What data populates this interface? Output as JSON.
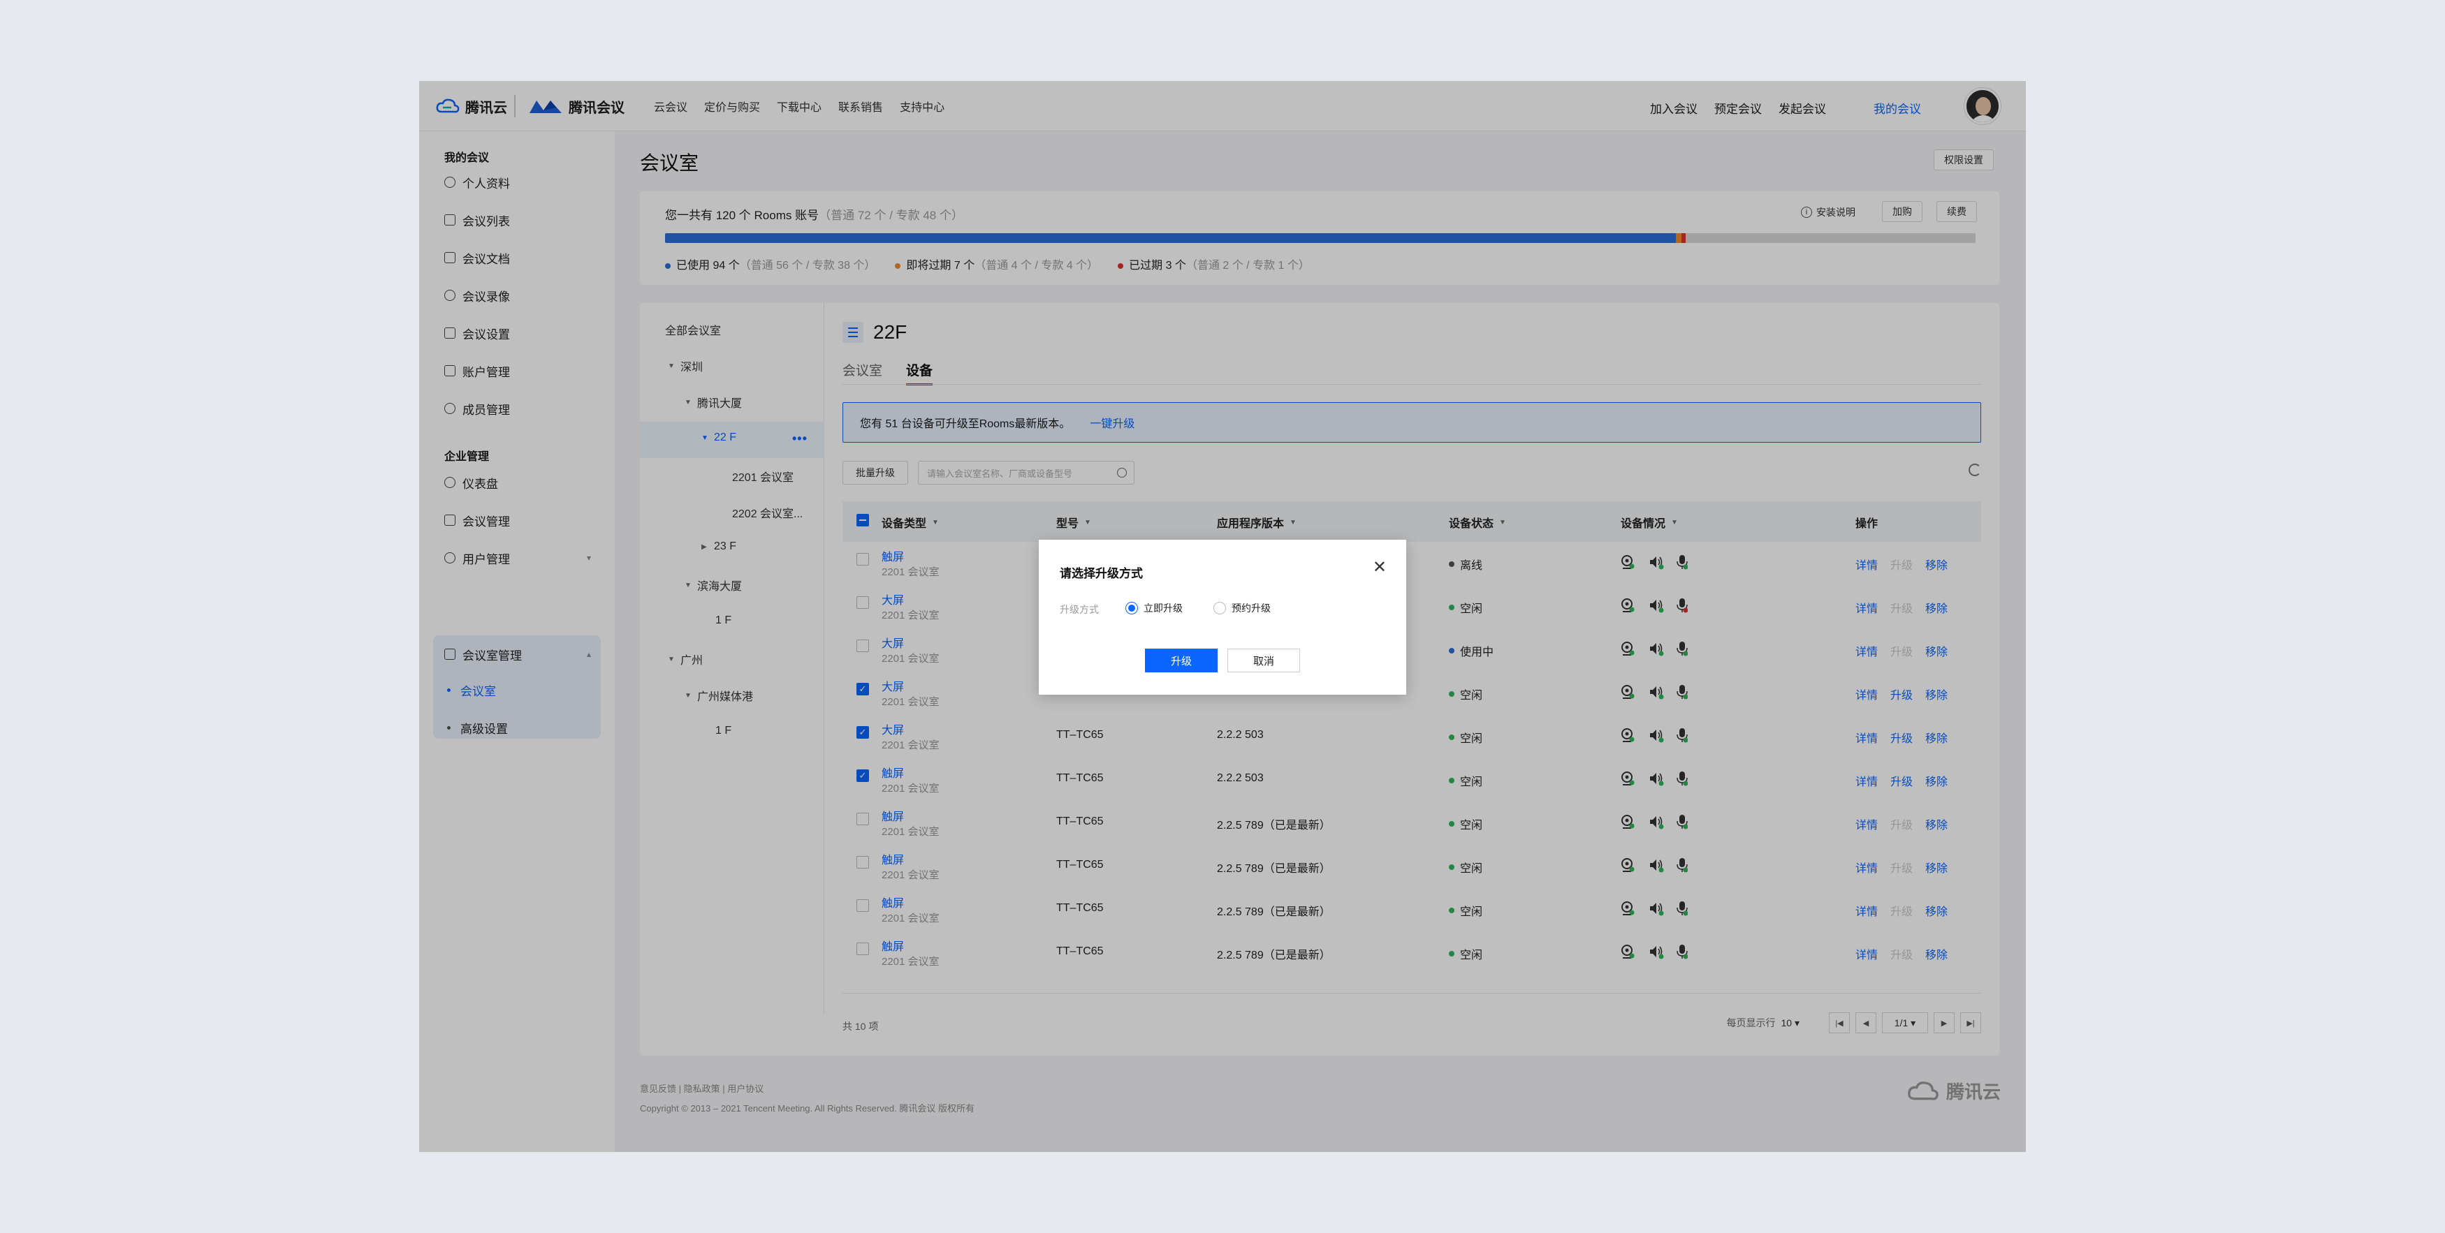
{
  "header": {
    "logo_cloud": "腾讯云",
    "logo_meeting": "腾讯会议",
    "nav": [
      "云会议",
      "定价与购买",
      "下载中心",
      "联系销售",
      "支持中心"
    ],
    "right_nav": [
      "加入会议",
      "预定会议",
      "发起会议",
      "我的会议"
    ]
  },
  "sidebar": {
    "group1": "我的会议",
    "items1": [
      {
        "label": "个人资料",
        "icon": "user-icon"
      },
      {
        "label": "会议列表",
        "icon": "list-icon"
      },
      {
        "label": "会议文档",
        "icon": "doc-icon"
      },
      {
        "label": "会议录像",
        "icon": "record-icon"
      },
      {
        "label": "会议设置",
        "icon": "settings-icon"
      },
      {
        "label": "账户管理",
        "icon": "account-icon"
      },
      {
        "label": "成员管理",
        "icon": "members-icon"
      }
    ],
    "group2": "企业管理",
    "items2": [
      {
        "label": "仪表盘",
        "icon": "dashboard-icon"
      },
      {
        "label": "会议管理",
        "icon": "meeting-mgmt-icon"
      },
      {
        "label": "用户管理",
        "icon": "user-mgmt-icon"
      },
      {
        "label": "会议室管理",
        "icon": "room-mgmt-icon"
      }
    ],
    "subitems": [
      "会议室",
      "高级设置"
    ]
  },
  "page": {
    "title": "会议室",
    "perm_btn": "权限设置"
  },
  "usage": {
    "summary": "您一共有 120 个 Rooms 账号",
    "summary_detail": "（普通 72 个 / 专款 48 个）",
    "install_label": "安装说明",
    "buy_btn": "加购",
    "renew_btn": "续费",
    "used_label": "已使用 94 个",
    "used_detail": "（普通 56 个 / 专款 38 个）",
    "expiring_label": "即将过期 7 个",
    "expiring_detail": "（普通 4 个 / 专款 4 个）",
    "expired_label": "已过期 3 个",
    "expired_detail": "（普通 2 个 / 专款 1 个）",
    "used_count": 94,
    "expiring_count": 7,
    "expired_count": 3,
    "total_count": 120,
    "colors": {
      "used": "#2a6fd8",
      "expiring": "#f08a24",
      "expired": "#e03131"
    }
  },
  "tree": {
    "root": "全部会议室",
    "nodes": [
      "深圳",
      "腾讯大厦",
      "22 F",
      "2201 会议室",
      "2202 会议室...",
      "23 F",
      "滨海大厦",
      "1 F",
      "广州",
      "广州媒体港",
      "1 F"
    ]
  },
  "room": {
    "title": "22F",
    "tabs": [
      "会议室",
      "设备"
    ],
    "notice": "您有 51 台设备可升级至Rooms最新版本。",
    "notice_link": "一键升级",
    "batch_btn": "批量升级",
    "search_placeholder": "请输入会议室名称、厂商或设备型号",
    "columns": [
      "设备类型",
      "型号",
      "应用程序版本",
      "设备状态",
      "设备情况",
      "操作"
    ],
    "rows": [
      {
        "type": "触屏",
        "room": "2201 会议室",
        "model": "",
        "version": "",
        "status": "离线",
        "status_color": "#555555",
        "checked": false,
        "upgrade_enabled": false,
        "mic_alert": false
      },
      {
        "type": "大屏",
        "room": "2201 会议室",
        "model": "",
        "version": "",
        "status": "空闲",
        "status_color": "#2fb35a",
        "checked": false,
        "upgrade_enabled": false,
        "mic_alert": true
      },
      {
        "type": "大屏",
        "room": "2201 会议室",
        "model": "",
        "version": "",
        "status": "使用中",
        "status_color": "#2a6fd8",
        "checked": false,
        "upgrade_enabled": false,
        "mic_alert": false
      },
      {
        "type": "大屏",
        "room": "2201 会议室",
        "model": "TT–TC65",
        "version": "2.2.2 503",
        "status": "空闲",
        "status_color": "#2fb35a",
        "checked": true,
        "upgrade_enabled": true,
        "mic_alert": false
      },
      {
        "type": "大屏",
        "room": "2201 会议室",
        "model": "TT–TC65",
        "version": "2.2.2 503",
        "status": "空闲",
        "status_color": "#2fb35a",
        "checked": true,
        "upgrade_enabled": true,
        "mic_alert": false
      },
      {
        "type": "触屏",
        "room": "2201 会议室",
        "model": "TT–TC65",
        "version": "2.2.2 503",
        "status": "空闲",
        "status_color": "#2fb35a",
        "checked": true,
        "upgrade_enabled": true,
        "mic_alert": false
      },
      {
        "type": "触屏",
        "room": "2201 会议室",
        "model": "TT–TC65",
        "version": "2.2.5 789（已是最新）",
        "status": "空闲",
        "status_color": "#2fb35a",
        "checked": false,
        "upgrade_enabled": false,
        "mic_alert": false
      },
      {
        "type": "触屏",
        "room": "2201 会议室",
        "model": "TT–TC65",
        "version": "2.2.5 789（已是最新）",
        "status": "空闲",
        "status_color": "#2fb35a",
        "checked": false,
        "upgrade_enabled": false,
        "mic_alert": false
      },
      {
        "type": "触屏",
        "room": "2201 会议室",
        "model": "TT–TC65",
        "version": "2.2.5 789（已是最新）",
        "status": "空闲",
        "status_color": "#2fb35a",
        "checked": false,
        "upgrade_enabled": false,
        "mic_alert": false
      },
      {
        "type": "触屏",
        "room": "2201 会议室",
        "model": "TT–TC65",
        "version": "2.2.5 789（已是最新）",
        "status": "空闲",
        "status_color": "#2fb35a",
        "checked": false,
        "upgrade_enabled": false,
        "mic_alert": false
      }
    ],
    "ops": {
      "detail": "详情",
      "upgrade": "升级",
      "remove": "移除"
    },
    "total": "共 10 项",
    "per_page_label": "每页显示行",
    "per_page": "10",
    "page_indicator": "1/1"
  },
  "footer": {
    "links": "意见反馈 | 隐私政策 | 用户协议",
    "copyright": "Copyright © 2013 – 2021 Tencent Meeting. All Rights Reserved.  腾讯会议 版权所有",
    "logo": "腾讯云"
  },
  "dialog": {
    "title": "请选择升级方式",
    "label": "升级方式",
    "option_now": "立即升级",
    "option_schedule": "预约升级",
    "selected": "立即升级",
    "ok": "升级",
    "cancel": "取消"
  }
}
